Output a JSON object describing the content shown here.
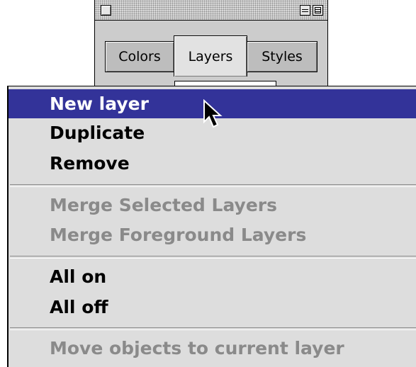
{
  "palette": {
    "tabs": [
      {
        "label": "Colors"
      },
      {
        "label": "Layers"
      },
      {
        "label": "Styles"
      }
    ],
    "active_tab": "Layers"
  },
  "menu": {
    "items": [
      {
        "label": "New layer",
        "state": "selected"
      },
      {
        "label": "Duplicate",
        "state": "enabled"
      },
      {
        "label": "Remove",
        "state": "enabled"
      },
      {
        "label": "Merge Selected Layers",
        "state": "disabled"
      },
      {
        "label": "Merge Foreground Layers",
        "state": "disabled"
      },
      {
        "label": "All on",
        "state": "enabled"
      },
      {
        "label": "All off",
        "state": "enabled"
      },
      {
        "label": "Move objects to current layer",
        "state": "disabled"
      }
    ]
  },
  "colors": {
    "highlight": "#333399",
    "menu_background": "#dddddd",
    "disabled_text": "#8a8a8a"
  },
  "icons": {
    "cursor": "arrow-cursor-icon",
    "close": "close-box-icon",
    "zoom": "zoom-box-icon",
    "collapse": "collapse-box-icon"
  }
}
